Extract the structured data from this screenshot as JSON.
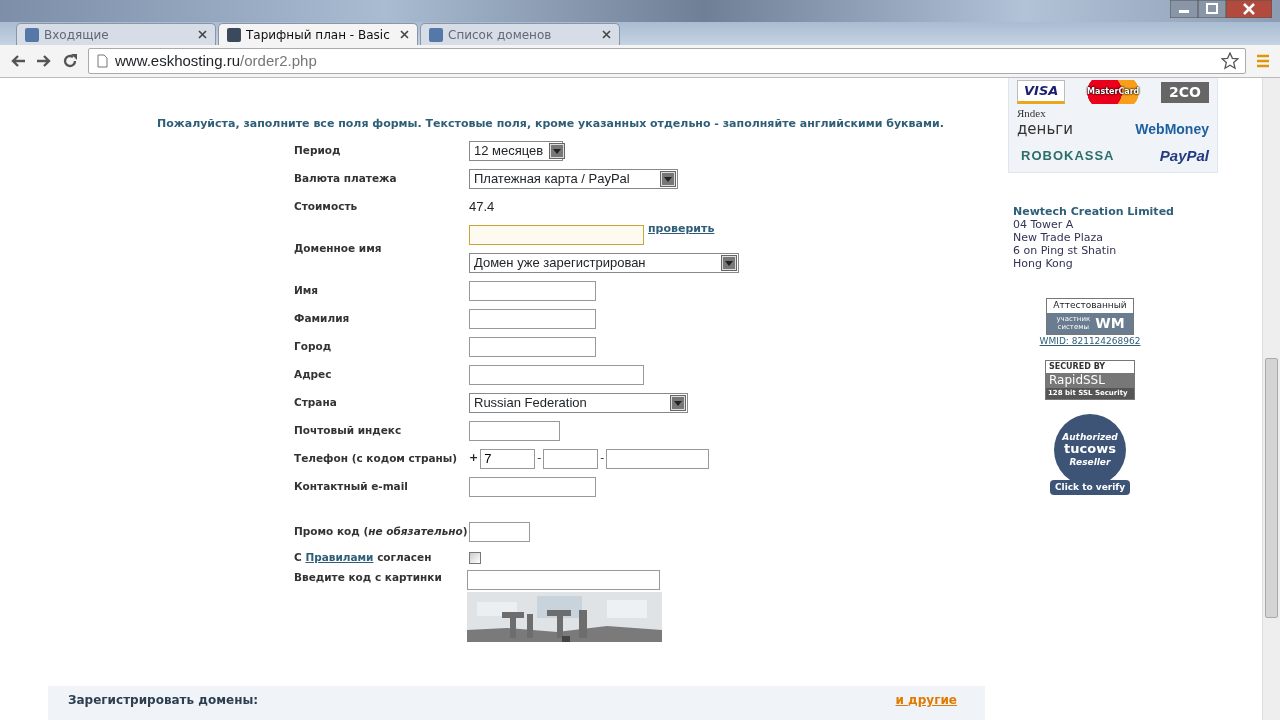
{
  "browser": {
    "tabs": [
      {
        "title": "Входящие",
        "selected": false
      },
      {
        "title": "Тарифный план - Basic",
        "selected": true
      },
      {
        "title": "Список доменов",
        "selected": false
      }
    ],
    "url_host": "www.eskhosting.ru",
    "url_path": "/order2.php"
  },
  "notice": "Пожалуйста, заполните все поля формы. Текстовые поля, кроме указанных отдельно - заполняйте английскими буквами.",
  "form": [
    {
      "kind": "select",
      "label": "Период",
      "value": "12 месяцев"
    },
    {
      "kind": "select",
      "label": "Валюта платежа",
      "value": "Платежная карта / PayPal"
    },
    {
      "kind": "text",
      "label": "Стоимость",
      "value": "47.4"
    },
    {
      "kind": "domain",
      "label": "Доменное имя",
      "focused": true,
      "link": "проверить",
      "option": "Домен уже зарегистрирован"
    },
    {
      "kind": "input",
      "label": "Имя"
    },
    {
      "kind": "input",
      "label": "Фамилия"
    },
    {
      "kind": "input",
      "label": "Город"
    },
    {
      "kind": "input",
      "label": "Адрес"
    },
    {
      "kind": "select",
      "label": "Страна",
      "value": "Russian Federation"
    },
    {
      "kind": "input",
      "label": "Почтовый индекс"
    },
    {
      "kind": "phone",
      "label": "Телефон (с кодом страны)",
      "prefix": "+",
      "separator": "-",
      "parts": [
        {
          "kind": "input",
          "value": "7"
        },
        {
          "kind": "input"
        },
        {
          "kind": "input"
        }
      ]
    },
    {
      "kind": "input",
      "label": "Контактный e-mail"
    },
    {
      "kind": "input",
      "label": "Промо код (*не обязательно*)"
    },
    {
      "kind": "checkbox",
      "label_before": "С",
      "link": "Правилами",
      "label_after": "согласен",
      "checked": false
    },
    {
      "kind": "captcha",
      "label": "Введите код с картинки"
    }
  ],
  "sidebar": {
    "payment_logos": [
      "VISA",
      "MasterCard",
      "2CO",
      "Яndex",
      "деньги",
      "WebMoney",
      "ROBOKASSA",
      "PayPal"
    ],
    "company": {
      "name": "Newtech Creation Limited",
      "lines": [
        "04 Tower A",
        "New Trade Plaza",
        "6 on Ping st Shatin",
        "Hong Kong"
      ]
    },
    "wm_badge": {
      "top": "Аттестованный",
      "bottom": "участник системы",
      "mark": "WM",
      "link": "WMID: 821124268962"
    },
    "ssl_badge": {
      "top": "SECURED BY",
      "name": "RapidSSL",
      "bottom": "128 bit SSL Security"
    },
    "reseller_badge": {
      "top": "Authorized",
      "brand": "tucows",
      "bottom": "Reseller",
      "button": "Click to verify"
    }
  },
  "domains_band": {
    "title": "Зарегистрировать домены:",
    "link": "и другие"
  }
}
